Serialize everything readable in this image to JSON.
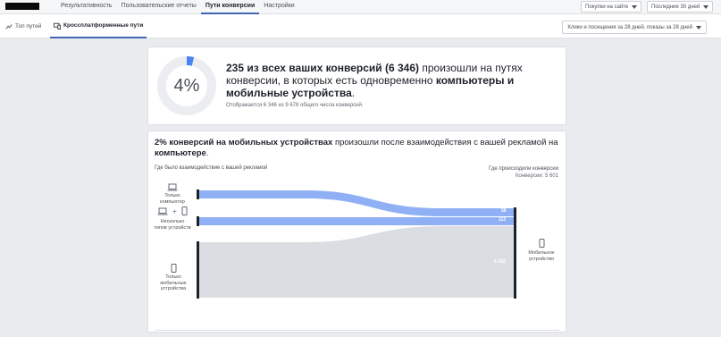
{
  "topnav": {
    "tabs": [
      {
        "label": "Результативность"
      },
      {
        "label": "Пользовательские отчеты"
      },
      {
        "label": "Пути конверсии"
      },
      {
        "label": "Настройки"
      }
    ],
    "event_select": "Покупки на сайте",
    "period_select": "Последние 30 дней"
  },
  "subnav": {
    "tabs": [
      {
        "label": "Топ путей"
      },
      {
        "label": "Кроссплатформенные пути"
      }
    ],
    "attribution_select": "Клики и посещения за 28 дней, показы за 28 дней"
  },
  "summary": {
    "percent": "4%",
    "percent_value": 4,
    "headline_bold": "235 из всех ваших конверсий (6 346)",
    "headline_text": " произошли на путях конверсии, в которых есть одновременно ",
    "headline_bold2": "компьютеры и мобильные устройства",
    "headline_end": ".",
    "footnote": "Отображается 6 346 из 9 678 общего числа конверсий."
  },
  "mobile_card": {
    "title_bold": "2% конверсий на мобильных устройствах",
    "title_text": " произошли после взаимодействия с вашей рекламой на ",
    "title_bold2": "компьютере",
    "title_end": ".",
    "left_label": "Где было взаимодействие с вашей рекламой",
    "right_label": "Где происходили конверсии",
    "right_sub": "Конверсии: 5 601",
    "sources": [
      {
        "label": "Только компьютер"
      },
      {
        "label": "Несколько типов устройств"
      },
      {
        "label": "Только мобильные устройства"
      }
    ],
    "plus": "+",
    "flows": [
      {
        "value": "56"
      },
      {
        "value": "113"
      },
      {
        "value": "5 432"
      }
    ],
    "destination": "Мобильное устройство"
  },
  "colors": {
    "accent": "#4267b2",
    "flow_blue": "#8fb0f5",
    "flow_gray": "#dadde1",
    "ring_track": "#ebedf0",
    "ring_fill": "#4a84f2"
  }
}
